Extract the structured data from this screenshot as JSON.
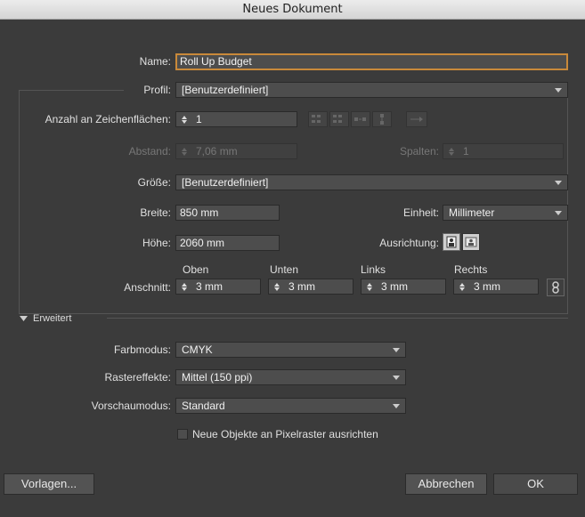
{
  "window": {
    "title": "Neues Dokument"
  },
  "name": {
    "label": "Name:",
    "value": "Roll Up Budget"
  },
  "profile": {
    "label": "Profil:",
    "value": "[Benutzerdefiniert]"
  },
  "artboards": {
    "label": "Anzahl an Zeichenflächen:",
    "value": "1"
  },
  "spacing": {
    "label": "Abstand:",
    "value": "7,06 mm"
  },
  "columns": {
    "label": "Spalten:",
    "value": "1"
  },
  "size": {
    "label": "Größe:",
    "value": "[Benutzerdefiniert]"
  },
  "width": {
    "label": "Breite:",
    "value": "850 mm"
  },
  "unit": {
    "label": "Einheit:",
    "value": "Millimeter"
  },
  "height": {
    "label": "Höhe:",
    "value": "2060 mm"
  },
  "orientation": {
    "label": "Ausrichtung:"
  },
  "bleed": {
    "label": "Anschnitt:",
    "top_label": "Oben",
    "top": "3 mm",
    "bottom_label": "Unten",
    "bottom": "3 mm",
    "left_label": "Links",
    "left": "3 mm",
    "right_label": "Rechts",
    "right": "3 mm"
  },
  "advanced": {
    "label": "Erweitert"
  },
  "color_mode": {
    "label": "Farbmodus:",
    "value": "CMYK"
  },
  "raster": {
    "label": "Rastereffekte:",
    "value": "Mittel (150 ppi)"
  },
  "preview": {
    "label": "Vorschaumodus:",
    "value": "Standard"
  },
  "pixel_grid": {
    "label": "Neue Objekte an Pixelraster ausrichten",
    "checked": false
  },
  "buttons": {
    "templates": "Vorlagen...",
    "cancel": "Abbrechen",
    "ok": "OK"
  },
  "colors": {
    "accent_focus": "#c9893a",
    "background": "#3b3b3b"
  }
}
